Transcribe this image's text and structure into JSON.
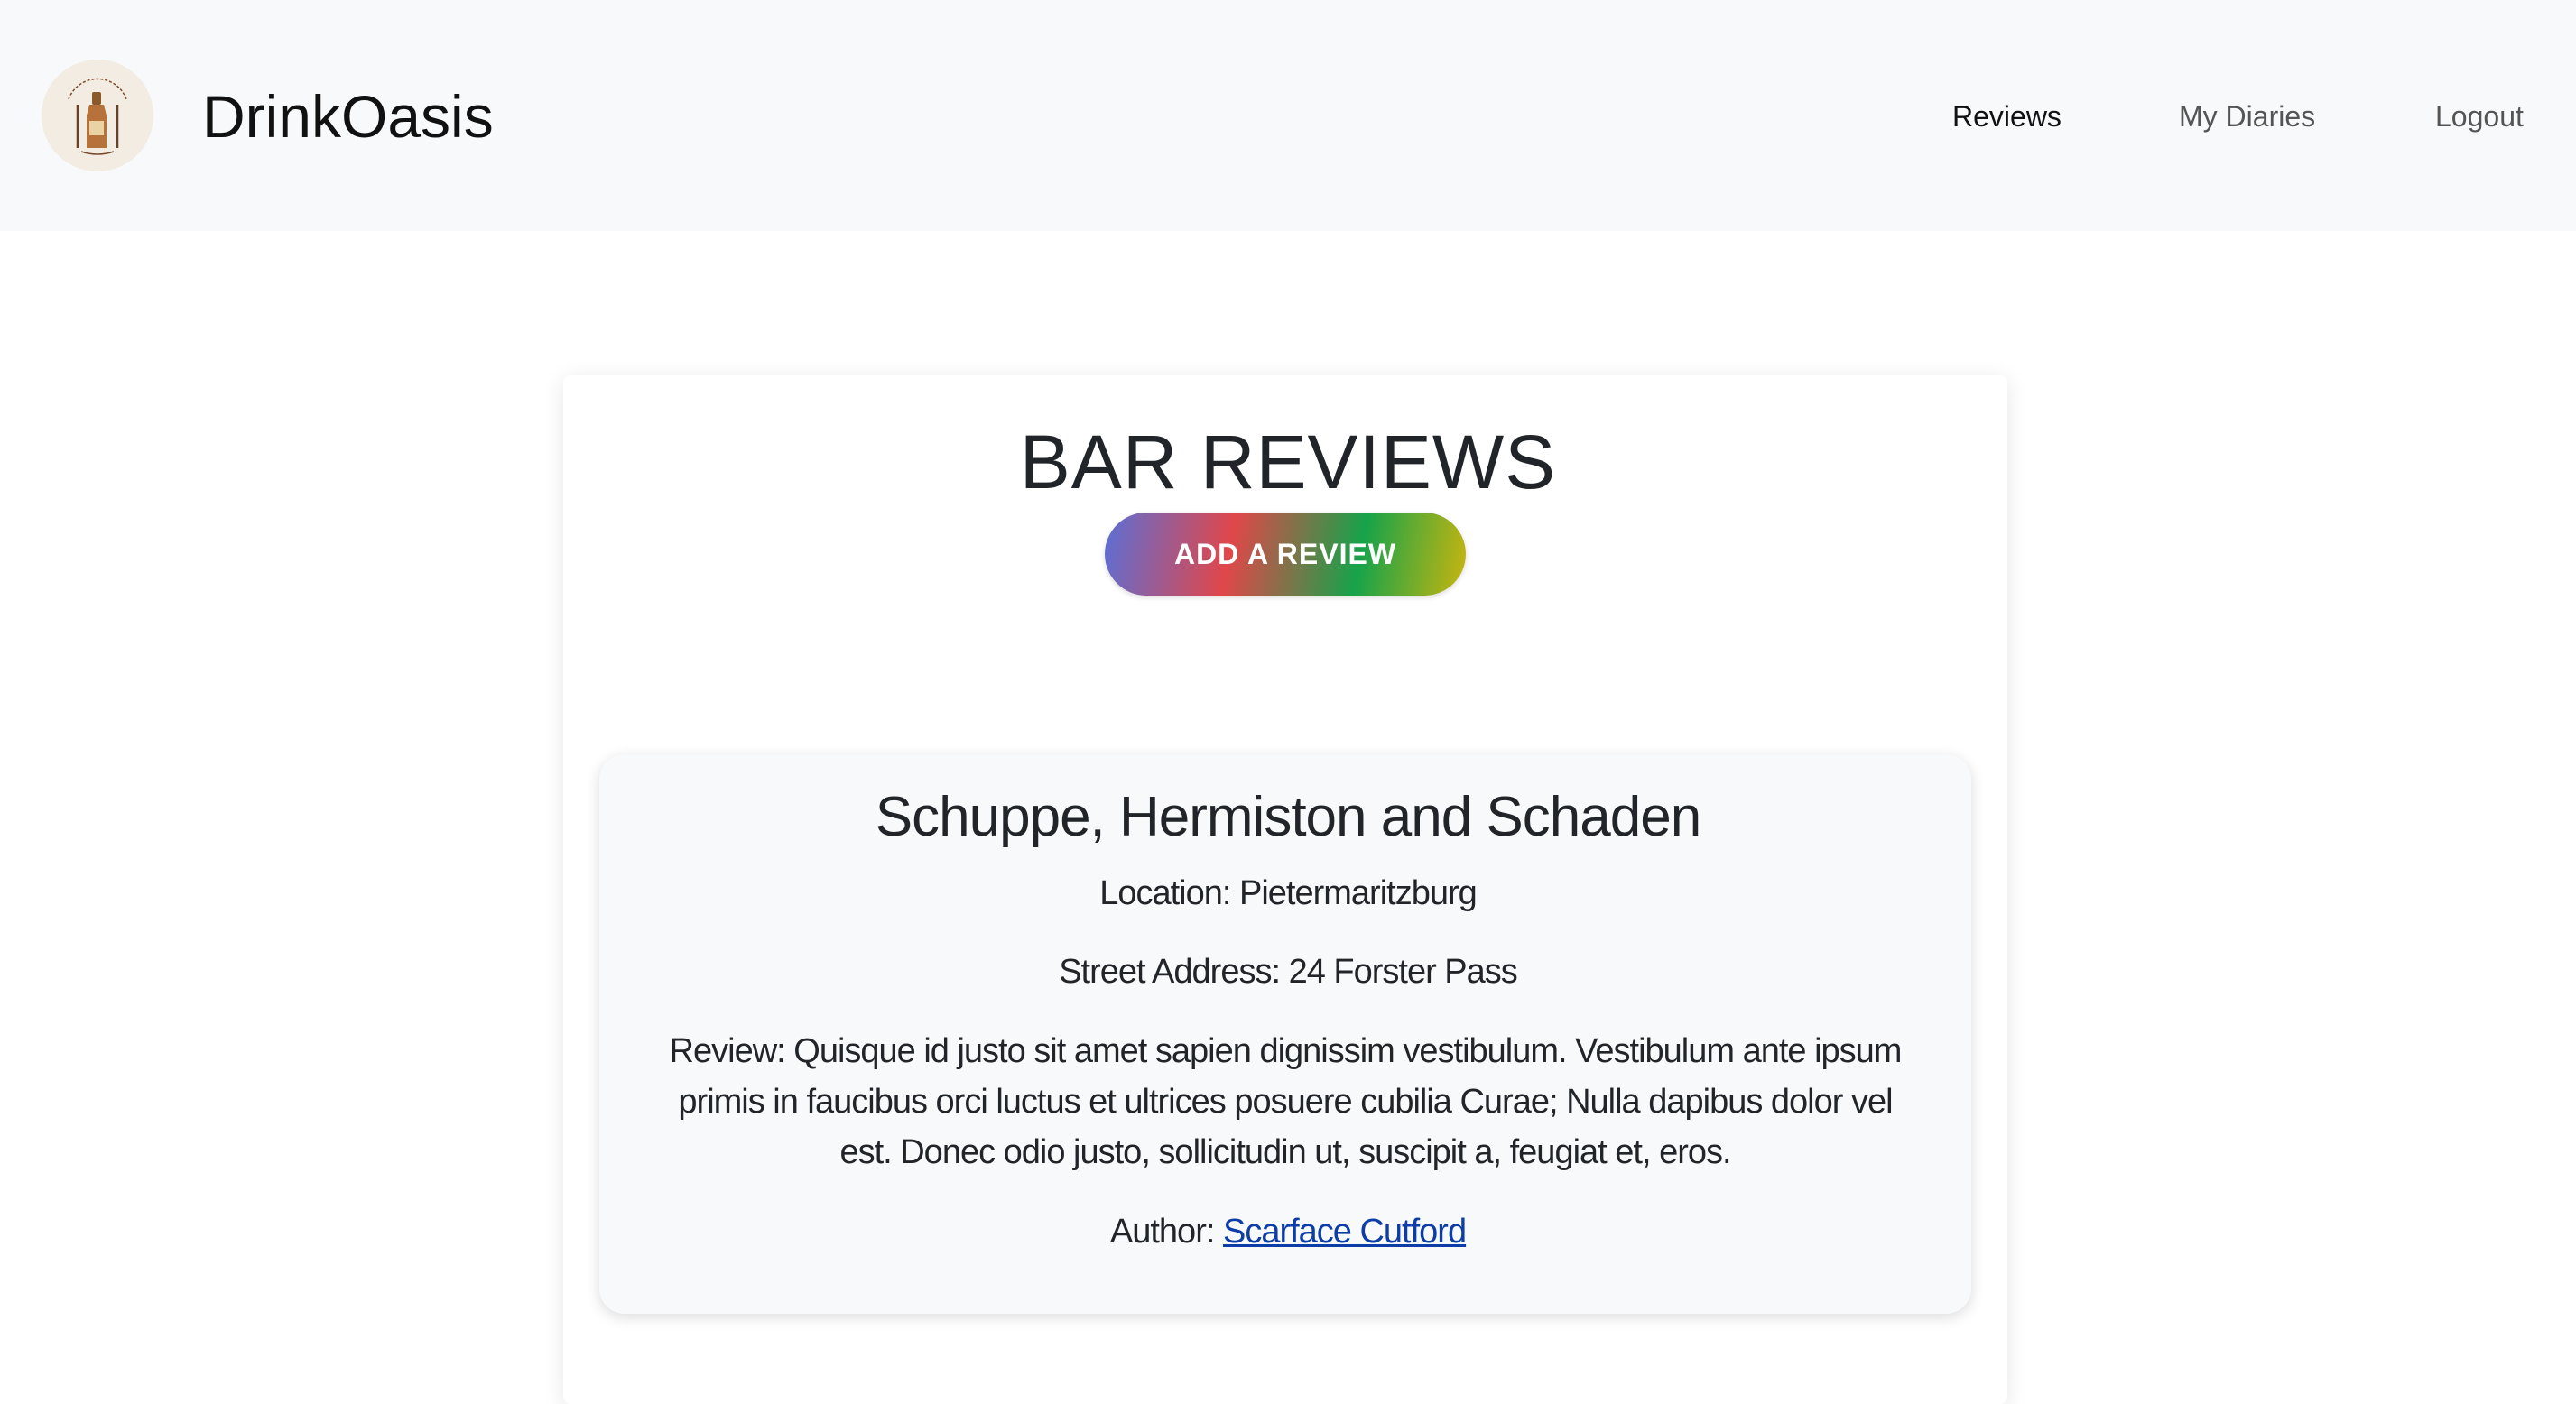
{
  "navbar": {
    "brand": "DrinkOasis",
    "logo_icon": "drinkoasis-bottle-logo-icon",
    "links": [
      {
        "label": "Reviews",
        "active": true
      },
      {
        "label": "My Diaries",
        "active": false
      },
      {
        "label": "Logout",
        "active": false
      }
    ]
  },
  "main": {
    "title": "BAR REVIEWS",
    "add_button": "ADD A REVIEW",
    "add_button_gradient": [
      "#5b6fd6",
      "#e0474a",
      "#16a34a",
      "#c9b50f"
    ],
    "reviews": [
      {
        "bar_name": "Schuppe, Hermiston and Schaden",
        "location": "Location: Pietermaritzburg",
        "street_address": "Street Address: 24 Forster Pass",
        "review": "Review: Quisque id justo sit amet sapien dignissim vestibulum. Vestibulum ante ipsum primis in faucibus orci luctus et ultrices posuere cubilia Curae; Nulla dapibus dolor vel est. Donec odio justo, sollicitudin ut, suscipit a, feugiat et, eros.",
        "author_label": "Author: ",
        "author_name": "Scarface Cutford"
      }
    ]
  },
  "colors": {
    "navbar_bg": "#f8f9fa",
    "link": "#0d3ea8",
    "text": "#212529"
  }
}
